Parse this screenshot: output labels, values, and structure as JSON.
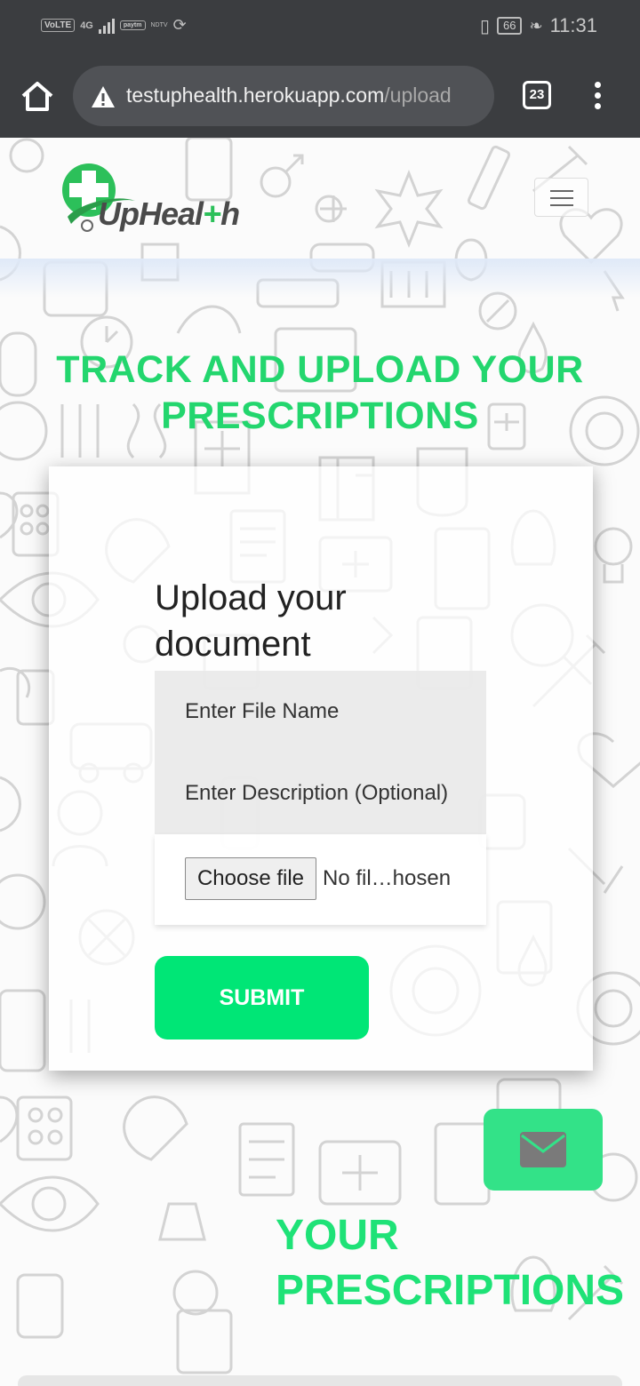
{
  "status_bar": {
    "left_chips": [
      "VoLTE",
      "4G",
      "paytm",
      "NDTV"
    ],
    "battery": "66",
    "time": "11:31"
  },
  "browser": {
    "url_host": "testuphealth.herokuapp.com",
    "url_path": "/upload",
    "tab_count": "23"
  },
  "header": {
    "logo_text_prefix": "UpHeal",
    "logo_text_plus": "+",
    "logo_text_suffix": "h"
  },
  "hero": {
    "title_line1": "TRACK AND UPLOAD YOUR",
    "title_line2": "PRESCRIPTIONS"
  },
  "upload_form": {
    "heading": "Upload your document",
    "file_name_placeholder": "Enter File Name",
    "description_placeholder": "Enter Description (Optional)",
    "choose_file_label": "Choose file",
    "no_file_text": "No fil…hosen",
    "submit_label": "SUBMIT"
  },
  "prescriptions_section": {
    "title_line1": "YOUR",
    "title_line2": "PRESCRIPTIONS"
  },
  "colors": {
    "accent_green": "#00e676",
    "title_green": "#23d66e",
    "browser_chrome": "#3b3d40"
  }
}
